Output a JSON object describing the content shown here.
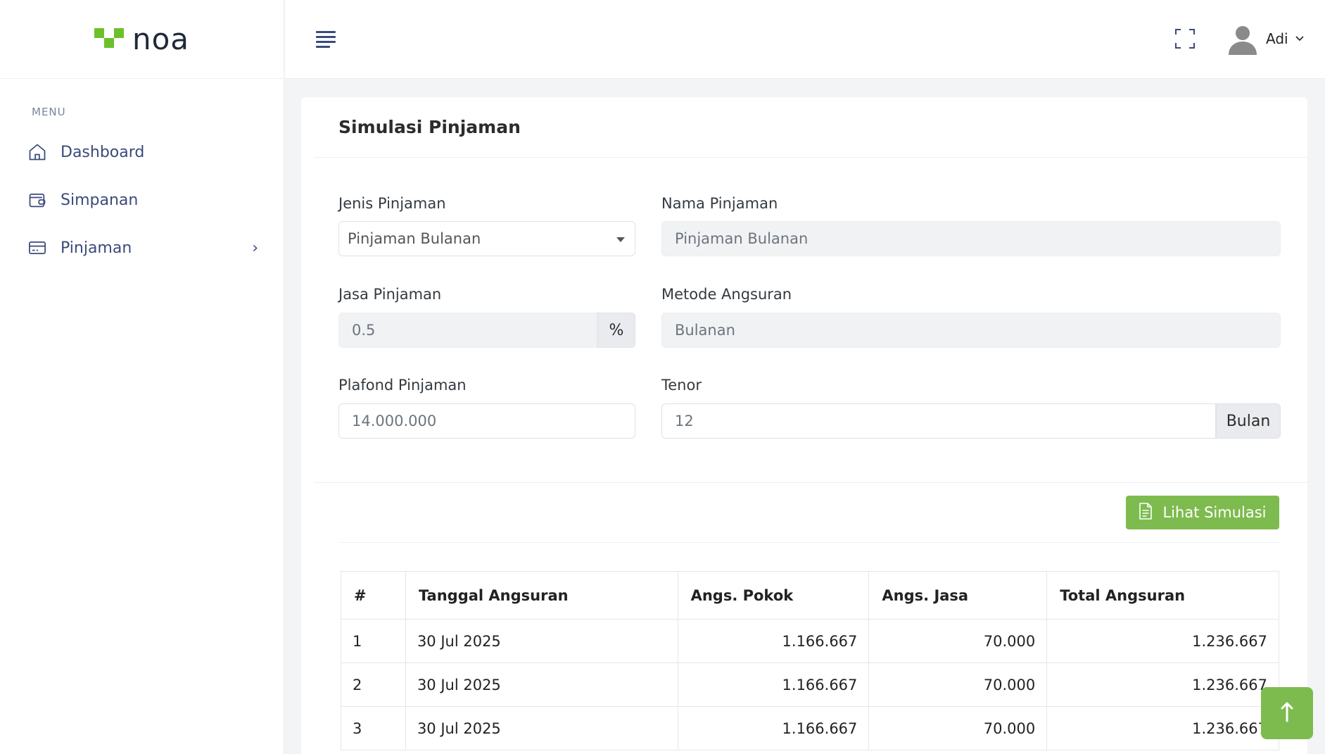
{
  "brand": {
    "name": "noa",
    "color": "#6cc02a"
  },
  "sidebar": {
    "menu_title": "MENU",
    "items": [
      {
        "label": "Dashboard",
        "icon": "home-icon"
      },
      {
        "label": "Simpanan",
        "icon": "wallet-icon"
      },
      {
        "label": "Pinjaman",
        "icon": "credit-card-icon",
        "has_submenu": true
      }
    ]
  },
  "topbar": {
    "user_name": "Adi"
  },
  "card": {
    "title": "Simulasi Pinjaman",
    "form": {
      "jenis_label": "Jenis Pinjaman",
      "jenis_value": "Pinjaman Bulanan",
      "nama_label": "Nama Pinjaman",
      "nama_value": "Pinjaman Bulanan",
      "jasa_label": "Jasa Pinjaman",
      "jasa_value": "0.5",
      "jasa_suffix": "%",
      "metode_label": "Metode Angsuran",
      "metode_value": "Bulanan",
      "plafond_label": "Plafond Pinjaman",
      "plafond_value": "14.000.000",
      "tenor_label": "Tenor",
      "tenor_value": "12",
      "tenor_suffix": "Bulan"
    },
    "button_label": "Lihat Simulasi",
    "table": {
      "headers": [
        "#",
        "Tanggal Angsuran",
        "Angs. Pokok",
        "Angs. Jasa",
        "Total Angsuran"
      ],
      "rows": [
        [
          "1",
          "30 Jul 2025",
          "1.166.667",
          "70.000",
          "1.236.667"
        ],
        [
          "2",
          "30 Jul 2025",
          "1.166.667",
          "70.000",
          "1.236.667"
        ],
        [
          "3",
          "30 Jul 2025",
          "1.166.667",
          "70.000",
          "1.236.667"
        ]
      ]
    }
  },
  "colors": {
    "accent": "#7dbb4f",
    "menu_text": "#3b4a7a"
  }
}
